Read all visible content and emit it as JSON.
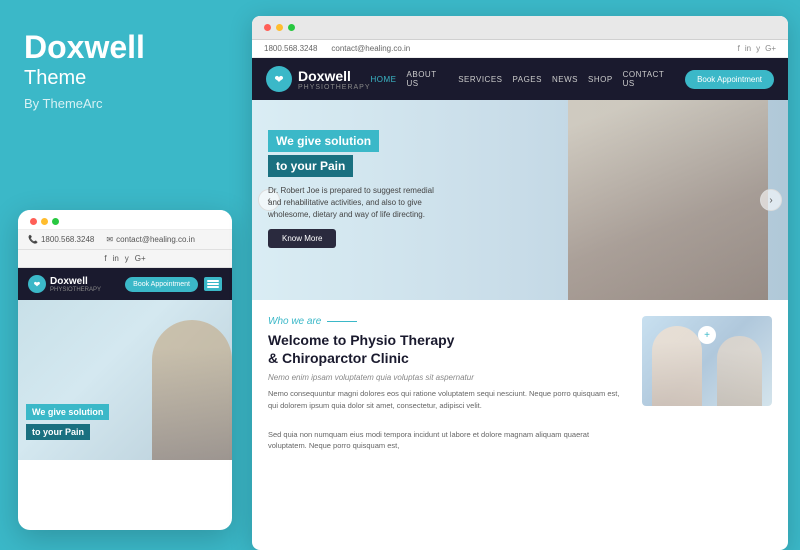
{
  "left": {
    "brand_name": "Doxwell",
    "brand_theme": "Theme",
    "brand_by": "By ThemeArc"
  },
  "mobile": {
    "phone": "1800.568.3248",
    "email": "contact@healing.co.in",
    "social": [
      "f",
      "in",
      "y",
      "G+"
    ],
    "logo_name": "Doxwell",
    "logo_sub": "PHYSIOTHERAPY",
    "book_btn": "Book Appointment",
    "hero_line1": "We give solution",
    "hero_line2": "to your Pain"
  },
  "website": {
    "topbar": {
      "phone": "1800.568.3248",
      "email": "contact@healing.co.in",
      "social": [
        "f",
        "in",
        "y",
        "G+"
      ]
    },
    "nav": {
      "logo_name": "Doxwell",
      "logo_sub": "PHYSIOTHERAPY",
      "links": [
        "HOME",
        "ABOUT US",
        "SERVICES",
        "PAGES",
        "NEWS",
        "SHOP",
        "CONTACT US"
      ],
      "book_btn": "Book Appointment"
    },
    "hero": {
      "line1": "We give solution",
      "line2": "to your Pain",
      "desc_line1": "Dr. Robert Joe is prepared to suggest remedial",
      "desc_line2": "and rehabilitative activities, and also to give",
      "desc_line3": "wholesome, dietary and way of life directing.",
      "know_more": "Know More"
    },
    "about": {
      "tag": "Who we are",
      "title_line1": "Welcome to Physio Therapy",
      "title_line2": "& Chiroparctor Clinic",
      "subtitle": "Nemo enim ipsam voluptatem quia voluptas sit aspernatur",
      "body1": "Nemo consequuntur magni dolores eos qui ratione voluptatem sequi nesciunt. Neque porro quisquam est, qui dolorem ipsum quia dolor sit amet, consectetur, adipisci velit.",
      "body2": "Sed quia non numquam eius modi tempora incidunt ut labore et dolore magnam aliquam quaerat voluptatem. Neque porro quisquam est,"
    }
  },
  "colors": {
    "accent": "#3bb8c8",
    "dark_nav": "#1a1a2e"
  }
}
